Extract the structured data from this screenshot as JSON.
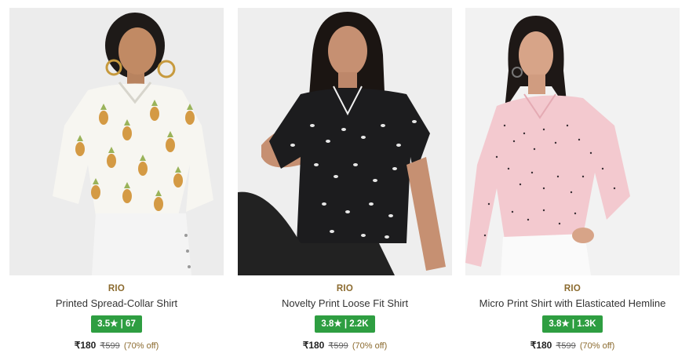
{
  "products": [
    {
      "brand": "RIO",
      "name": "Printed Spread-Collar Shirt",
      "rating": "3.5★ | 67",
      "price": "₹180",
      "mrp": "₹599",
      "discount": "(70% off)",
      "image": {
        "background": "#ececec",
        "top_color": "#f7f6f1",
        "pattern_color": "#9ab35a",
        "bottom_color": "#f4f4f4"
      }
    },
    {
      "brand": "RIO",
      "name": "Novelty Print Loose Fit Shirt",
      "rating": "3.8★ | 2.2K",
      "price": "₹180",
      "mrp": "₹599",
      "discount": "(70% off)",
      "image": {
        "background": "#eeeeee",
        "top_color": "#1c1c1e",
        "pattern_color": "#e8e8e8",
        "bottom_color": "#222222"
      }
    },
    {
      "brand": "RIO",
      "name": "Micro Print Shirt with Elasticated Hemline",
      "rating": "3.8★ | 1.3K",
      "price": "₹180",
      "mrp": "₹599",
      "discount": "(70% off)",
      "image": {
        "background": "#f2f2f2",
        "top_color": "#f3c9cf",
        "pattern_color": "#3a2f35",
        "bottom_color": "#fafafa"
      }
    }
  ],
  "colors": {
    "brand": "#8b6a2e",
    "rating_bg": "#2e9e41",
    "text": "#333333"
  }
}
